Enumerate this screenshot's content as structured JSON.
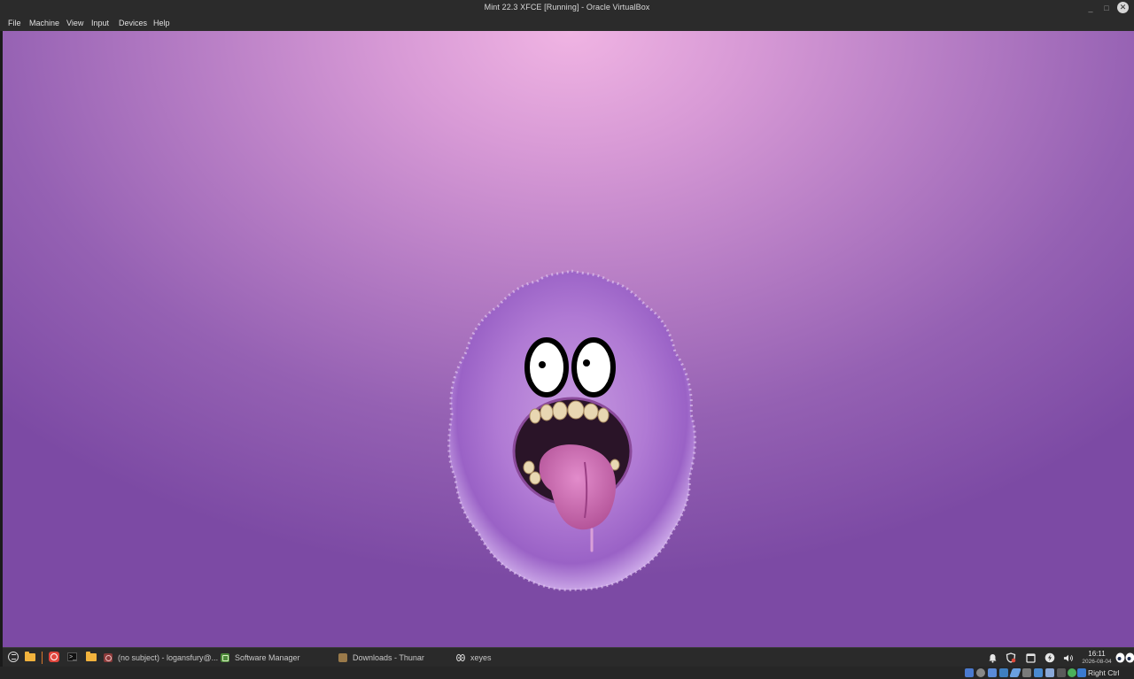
{
  "window": {
    "title": "Mint 22.3 XFCE [Running] - Oracle VirtualBox",
    "minimize_glyph": "_",
    "maximize_glyph": "□",
    "close_glyph": "✕"
  },
  "menubar": {
    "items": [
      "File",
      "Machine",
      "View",
      "Input",
      "Devices",
      "Help"
    ]
  },
  "desktop": {
    "wallpaper": "purple furry monster",
    "colors": {
      "bg_center": "#f0b4e3",
      "bg_edge": "#7c4aa4"
    }
  },
  "taskbar": {
    "launchers": [
      "whisker-menu-icon",
      "files-icon",
      "vivaldi-icon",
      "terminal-icon",
      "folder-icon"
    ],
    "tasks": [
      {
        "icon": "mail-icon",
        "label": "(no subject) - logansfury@..."
      },
      {
        "icon": "software-manager-icon",
        "label": "Software Manager"
      },
      {
        "icon": "thunar-icon",
        "label": "Downloads - Thunar"
      },
      {
        "icon": "xeyes-icon",
        "label": "xeyes"
      }
    ],
    "tray": [
      "bell-icon",
      "shield-update-icon",
      "window-icon",
      "power-icon",
      "volume-icon"
    ],
    "clock": {
      "time": "16:11",
      "date": "2026-08-04"
    }
  },
  "statusbar": {
    "host_key": "Right Ctrl"
  }
}
